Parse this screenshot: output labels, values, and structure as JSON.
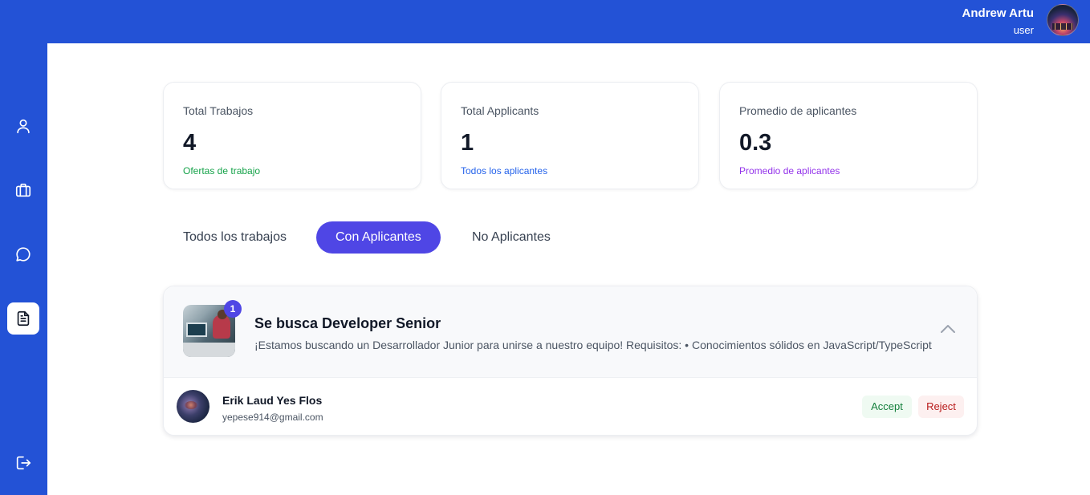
{
  "header": {
    "user_name": "Andrew Artu",
    "user_role": "user",
    "avatar_icon": "user-avatar"
  },
  "sidebar": {
    "items": [
      {
        "icon": "user-icon",
        "active": false
      },
      {
        "icon": "briefcase-icon",
        "active": false
      },
      {
        "icon": "chat-icon",
        "active": false
      },
      {
        "icon": "document-icon",
        "active": true
      }
    ],
    "logout_icon": "logout-icon"
  },
  "stats": [
    {
      "label": "Total Trabajos",
      "value": "4",
      "sub": "Ofertas de trabajo",
      "sub_color": "#16a34a"
    },
    {
      "label": "Total Applicants",
      "value": "1",
      "sub": "Todos los aplicantes",
      "sub_color": "#2563eb"
    },
    {
      "label": "Promedio de aplicantes",
      "value": "0.3",
      "sub": "Promedio de aplicantes",
      "sub_color": "#9333ea"
    }
  ],
  "tabs": [
    {
      "label": "Todos los trabajos",
      "active": false
    },
    {
      "label": "Con Aplicantes",
      "active": true
    },
    {
      "label": "No Aplicantes",
      "active": false
    }
  ],
  "job": {
    "badge_count": "1",
    "title": "Se busca Developer Senior",
    "description": "¡Estamos buscando un Desarrollador Junior para unirse a nuestro equipo! Requisitos: • Conocimientos sólidos en JavaScript/TypeScript",
    "expanded": true,
    "applicants": [
      {
        "name": "Erik Laud Yes Flos",
        "email": "yepese914@gmail.com",
        "accept_label": "Accept",
        "reject_label": "Reject"
      }
    ]
  },
  "colors": {
    "brand_blue": "#2352d6",
    "accent_indigo": "#4f46e5",
    "accept_green": "#15803d",
    "reject_red": "#b91c1c"
  }
}
